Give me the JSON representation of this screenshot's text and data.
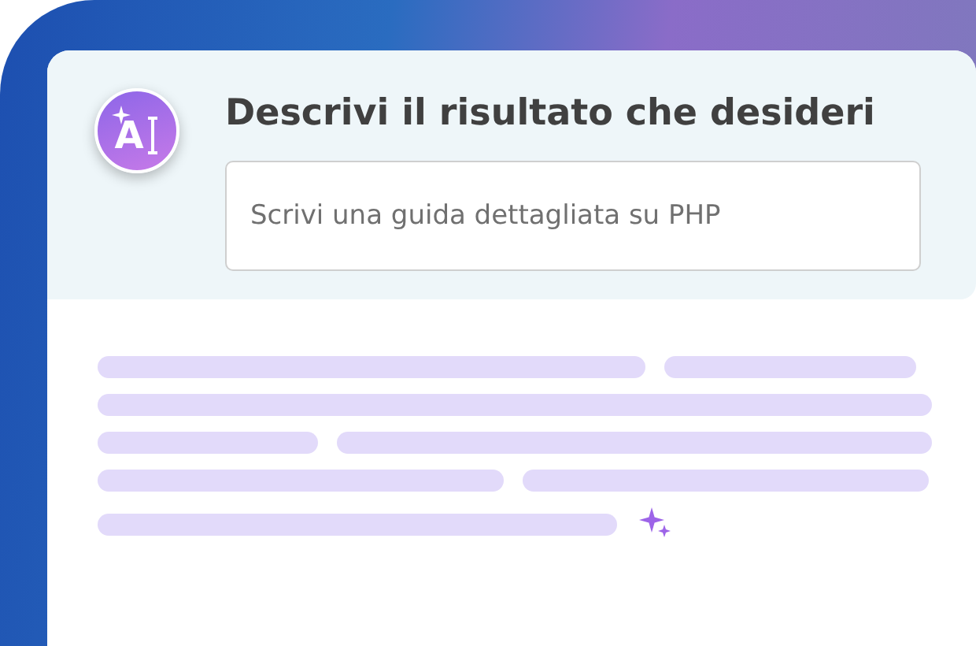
{
  "badge": {
    "letter": "A"
  },
  "prompt": {
    "title": "Descrivi il risultato che desideri",
    "placeholder": "Scrivi una guida dettagliata su PHP"
  }
}
